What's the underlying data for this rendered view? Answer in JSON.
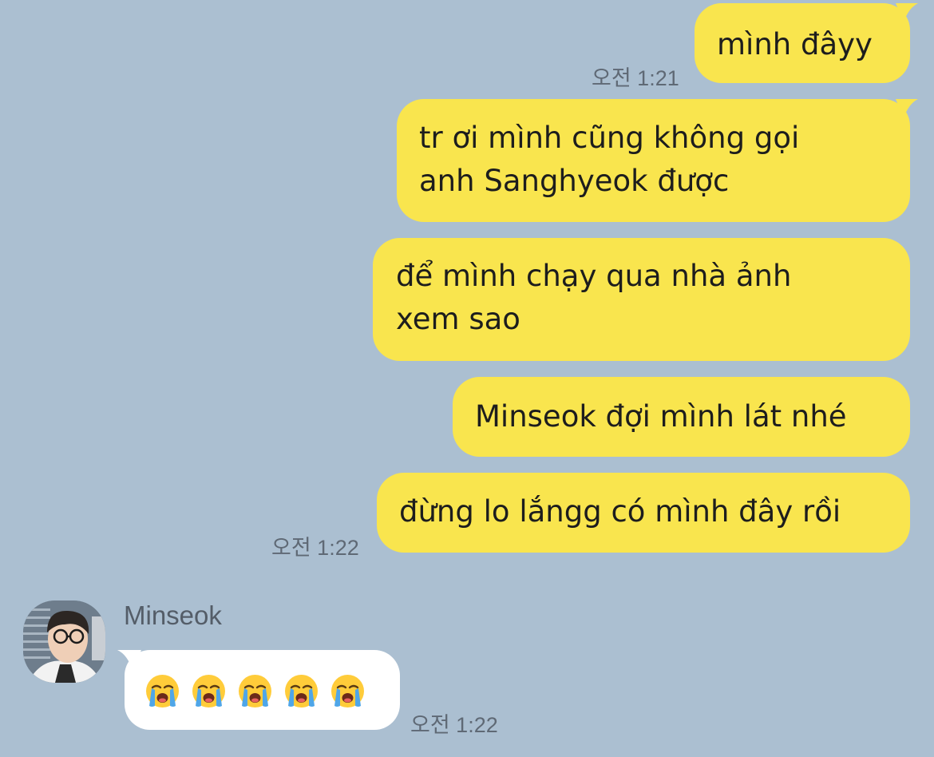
{
  "chat": {
    "messages": [
      {
        "text": "mình đâyy"
      },
      {
        "line1": "tr ơi mình cũng không gọi",
        "line2": "anh Sanghyeok được"
      },
      {
        "line1": "để mình chạy qua nhà ảnh",
        "line2": "xem sao"
      },
      {
        "text": "Minseok đợi mình lát nhé"
      },
      {
        "text": "đừng lo lắngg có mình đây rồi"
      }
    ],
    "times": {
      "first": "오전 1:21",
      "second": "오전 1:22",
      "incoming": "오전 1:22"
    },
    "incoming": {
      "sender": "Minseok",
      "emoji_count": 5,
      "emoji_icon": "loudly-crying-face-icon"
    }
  },
  "colors": {
    "background": "#abbfd1",
    "outgoing_bubble": "#f9e54e",
    "incoming_bubble": "#ffffff",
    "timestamp_text": "#5f6975"
  }
}
